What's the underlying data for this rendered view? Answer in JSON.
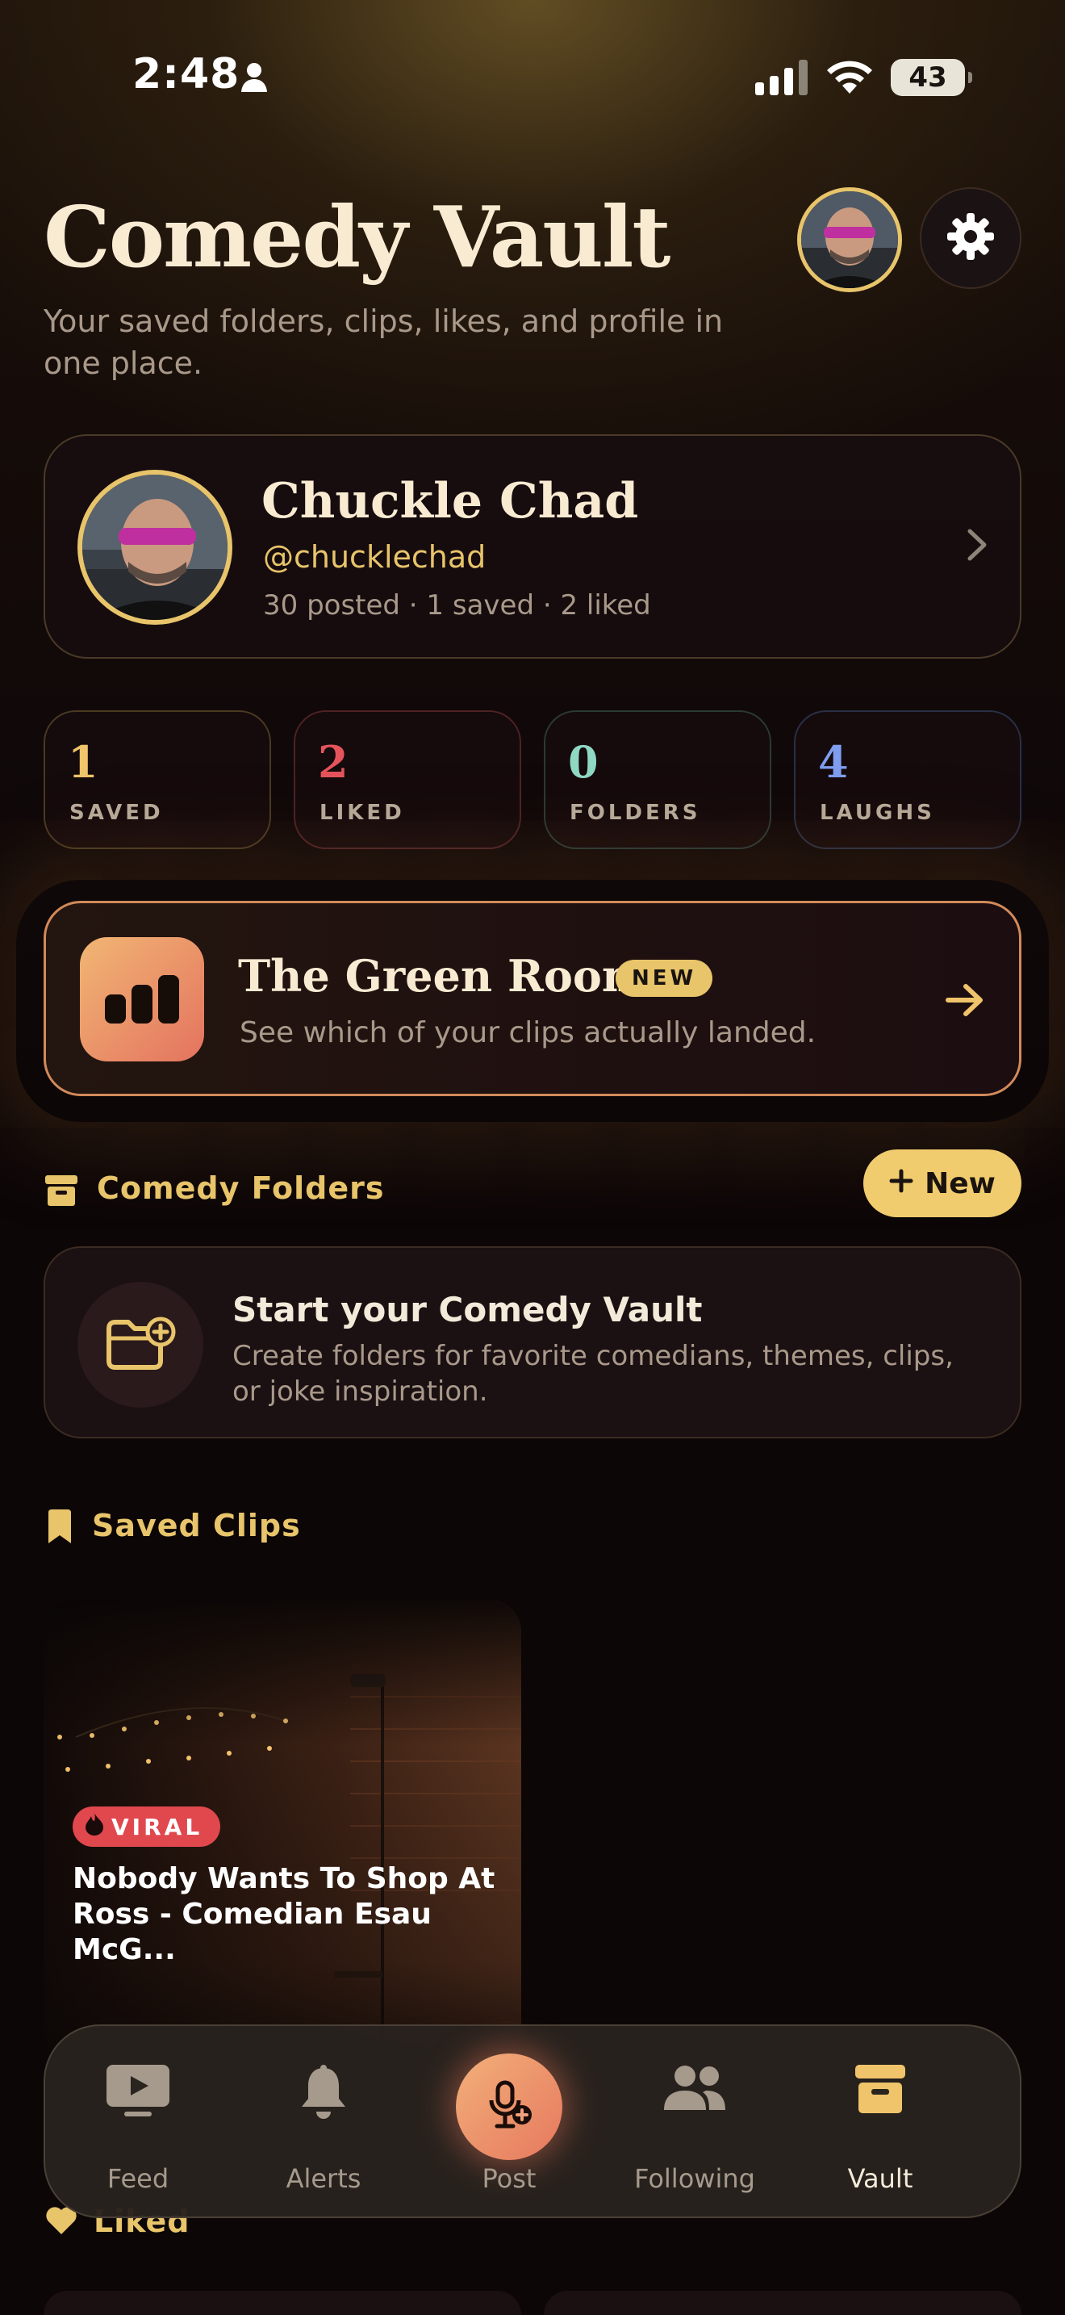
{
  "status_bar": {
    "time": "2:48",
    "battery": "43"
  },
  "header": {
    "title": "Comedy Vault",
    "subtitle": "Your saved folders, clips, likes, and profile in one place."
  },
  "profile": {
    "name": "Chuckle Chad",
    "handle": "@chucklechad",
    "stats": "30 posted · 1 saved · 2 liked"
  },
  "stats": [
    {
      "value": "1",
      "label": "SAVED",
      "color": "#f0c46a",
      "border": "#4a3a22"
    },
    {
      "value": "2",
      "label": "LIKED",
      "color": "#e5545a",
      "border": "#4e2226"
    },
    {
      "value": "0",
      "label": "FOLDERS",
      "color": "#8fd8c4",
      "border": "#2a3a36"
    },
    {
      "value": "4",
      "label": "LAUGHS",
      "color": "#7f9ef0",
      "border": "#2a3046"
    }
  ],
  "green_room": {
    "title": "The Green Room",
    "badge": "NEW",
    "subtitle": "See which of your clips actually landed."
  },
  "folders": {
    "section_title": "Comedy Folders",
    "new_button": "New",
    "empty_title": "Start your Comedy Vault",
    "empty_subtitle": "Create folders for favorite comedians, themes, clips, or joke inspiration."
  },
  "saved_clips": {
    "section_title": "Saved Clips",
    "items": [
      {
        "badge": "VIRAL",
        "title": "Nobody Wants To Shop At Ross - Comedian Esau McG..."
      }
    ]
  },
  "liked": {
    "section_title": "Liked"
  },
  "tabbar": {
    "items": [
      {
        "label": "Feed",
        "icon": "play-screen-icon",
        "active": false
      },
      {
        "label": "Alerts",
        "icon": "bell-icon",
        "active": false
      },
      {
        "label": "Post",
        "icon": "mic-plus-icon",
        "active": false
      },
      {
        "label": "Following",
        "icon": "people-icon",
        "active": false
      },
      {
        "label": "Vault",
        "icon": "archive-icon",
        "active": true
      }
    ]
  },
  "colors": {
    "accent": "#e8c46a",
    "background": "#0c0607",
    "viral": "#e0484e"
  }
}
